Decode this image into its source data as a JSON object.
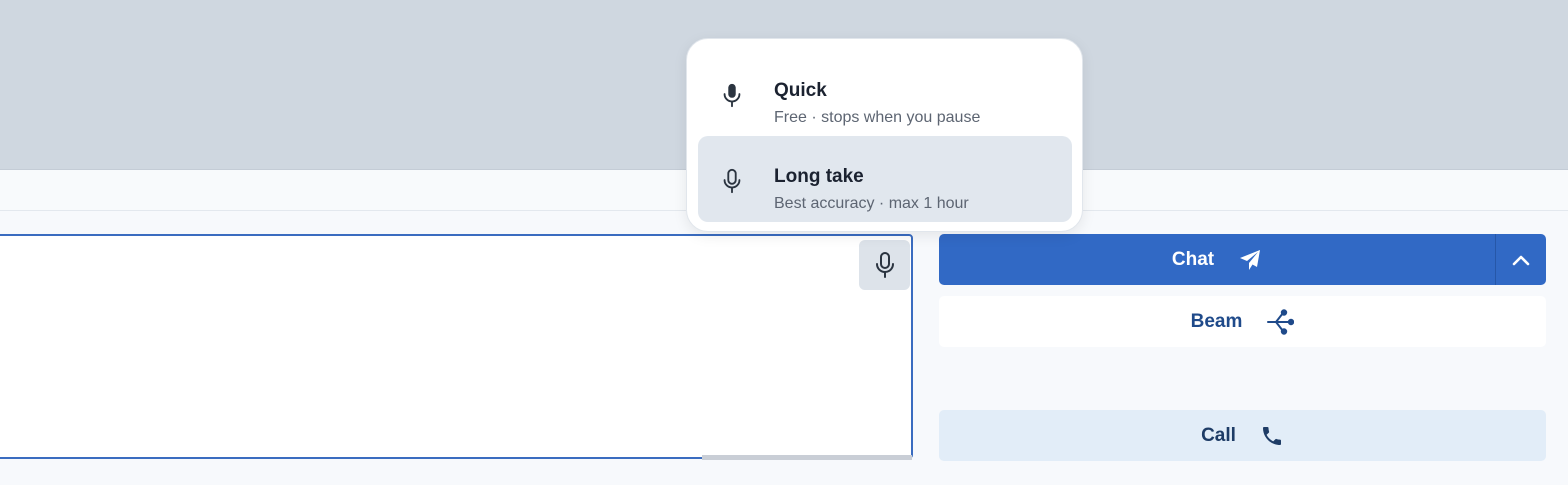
{
  "voice_menu": {
    "items": [
      {
        "title": "Quick",
        "subtitle": "Free · stops when you pause",
        "icon": "mic-filled-icon",
        "selected": false
      },
      {
        "title": "Long take",
        "subtitle": "Best accuracy · max 1 hour",
        "icon": "mic-outline-icon",
        "selected": true
      }
    ]
  },
  "composer": {
    "mic_icon": "mic-outline-icon"
  },
  "actions": {
    "chat_label": "Chat",
    "chat_icon": "send-icon",
    "chat_expand_icon": "chevron-up-icon",
    "beam_label": "Beam",
    "beam_icon": "fork-icon",
    "call_label": "Call",
    "call_icon": "phone-icon"
  },
  "colors": {
    "accent": "#3169c5",
    "selected_item_bg": "#e1e7ee",
    "call_bg": "#e2edf8",
    "backdrop": "#cfd7e0"
  }
}
